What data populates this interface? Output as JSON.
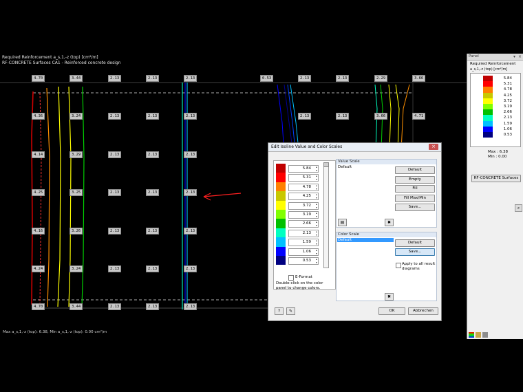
{
  "view": {
    "heading_line1": "Required Reinforcement a_s,1,-z (top) [cm²/m]",
    "heading_line2": "RF-CONCRETE Surfaces CA1 - Reinforced concrete design",
    "footer": "Max a_s,1,-z (top): 6.38, Min a_s,1,-z (top): 0.00 cm²/m",
    "labels_row1": [
      "4.70",
      "3.44",
      "2.13",
      "2.13",
      "2.13",
      "0.53",
      "2.13",
      "2.13",
      "2.29",
      "3.66"
    ],
    "labels_row2": [
      "4.36",
      "3.24",
      "2.13",
      "2.13",
      "2.13",
      "2.13",
      "2.13",
      "3.66",
      "4.71"
    ],
    "labels_grid": [
      "4.14",
      "3.29",
      "2.13",
      "2.13",
      "2.13"
    ],
    "labels_row4": [
      "4.25",
      "3.25",
      "2.13",
      "2.13",
      "2.13"
    ],
    "labels_row5": [
      "4.16",
      "3.26",
      "2.13",
      "2.13",
      "2.13"
    ],
    "labels_row6": [
      "4.24",
      "3.24",
      "2.13",
      "2.13",
      "2.13"
    ],
    "labels_bottom": [
      "4.70",
      "3.44",
      "2.13",
      "2.13",
      "2.13"
    ]
  },
  "panel": {
    "title": "Panel",
    "heading": "Required Reinforcement",
    "subheading": "a_s,1,-z (top) [cm²/m]",
    "legend": [
      {
        "value": "5.84",
        "color": "#c00000"
      },
      {
        "value": "5.31",
        "color": "#ff0000"
      },
      {
        "value": "4.78",
        "color": "#ff8000"
      },
      {
        "value": "4.25",
        "color": "#c8c800"
      },
      {
        "value": "3.72",
        "color": "#ffff00"
      },
      {
        "value": "3.19",
        "color": "#80ff00"
      },
      {
        "value": "2.66",
        "color": "#00c000"
      },
      {
        "value": "2.13",
        "color": "#00ffc0"
      },
      {
        "value": "1.59",
        "color": "#00c0ff"
      },
      {
        "value": "1.06",
        "color": "#0000ff"
      },
      {
        "value": "0.53",
        "color": "#000080"
      }
    ],
    "max_label": "Max :",
    "max_value": "6.38",
    "min_label": "Min :",
    "min_value": "0.00",
    "surfaces_button": "RF-CONCRETE Surfaces"
  },
  "dialog": {
    "title": "Edit Isoline Value and Color Scales",
    "values": [
      "5.84",
      "5.31",
      "4.78",
      "4.25",
      "3.72",
      "3.19",
      "2.66",
      "2.13",
      "1.59",
      "1.06",
      "0.53"
    ],
    "colors": [
      "#c00000",
      "#ff0000",
      "#ff8000",
      "#c8c800",
      "#ffff00",
      "#80ff00",
      "#00c000",
      "#00ffc0",
      "#00c0ff",
      "#0000ff",
      "#000080"
    ],
    "eformat_label": "E-Format",
    "hint": "Double-click on the color panel to change colors.",
    "value_scale_title": "Value Scale",
    "value_scale_item": "Default",
    "value_buttons": [
      "Default",
      "Empty",
      "Fill",
      "Fill Max/Min",
      "Save..."
    ],
    "color_scale_title": "Color Scale",
    "color_scale_item": "Default",
    "color_buttons": [
      "Default",
      "Save..."
    ],
    "apply_all_label": "Apply to all result diagrams",
    "ok": "OK",
    "cancel": "Abbrechen"
  }
}
